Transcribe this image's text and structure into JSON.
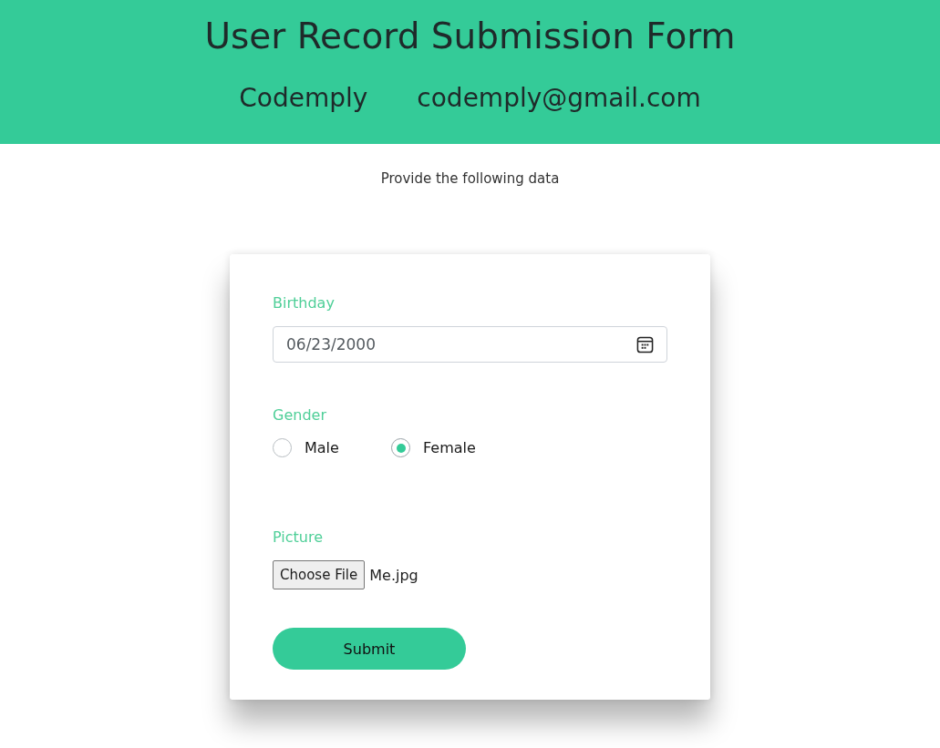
{
  "header": {
    "title": "User Record Submission Form",
    "name": "Codemply",
    "email": "codemply@gmail.com"
  },
  "intro": "Provide the following data",
  "form": {
    "birthday": {
      "label": "Birthday",
      "value": "06/23/2000"
    },
    "gender": {
      "label": "Gender",
      "options": [
        {
          "label": "Male",
          "selected": false
        },
        {
          "label": "Female",
          "selected": true
        }
      ]
    },
    "picture": {
      "label": "Picture",
      "button": "Choose File",
      "file_name": "Me.jpg"
    },
    "submit": "Submit"
  }
}
